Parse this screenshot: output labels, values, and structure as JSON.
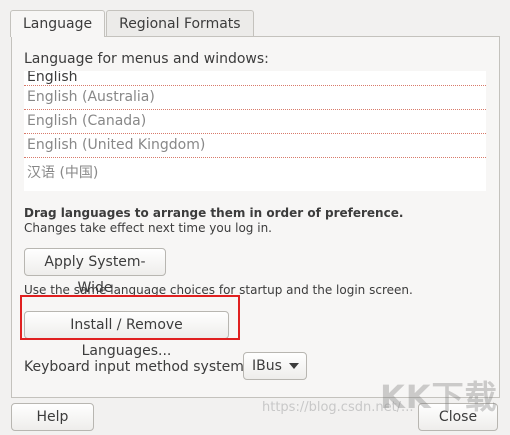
{
  "tabs": [
    {
      "label": "Language"
    },
    {
      "label": "Regional Formats"
    }
  ],
  "language": {
    "heading": "Language for menus and windows:",
    "items": [
      "English",
      "English (Australia)",
      "English (Canada)",
      "English (United Kingdom)",
      "汉语 (中国)"
    ],
    "drag_hint": "Drag languages to arrange them in order of preference.",
    "change_hint": "Changes take effect next time you log in.",
    "apply_button": "Apply System-Wide",
    "apply_hint": "Use the same language choices for startup and the login screen.",
    "install_button": "Install / Remove Languages...",
    "keyboard_label": "Keyboard input method system:",
    "keyboard_value": "IBus"
  },
  "footer": {
    "help_button": "Help",
    "close_button": "Close"
  },
  "watermark": "https://blog.csdn.net/...",
  "logo": "KK下载"
}
